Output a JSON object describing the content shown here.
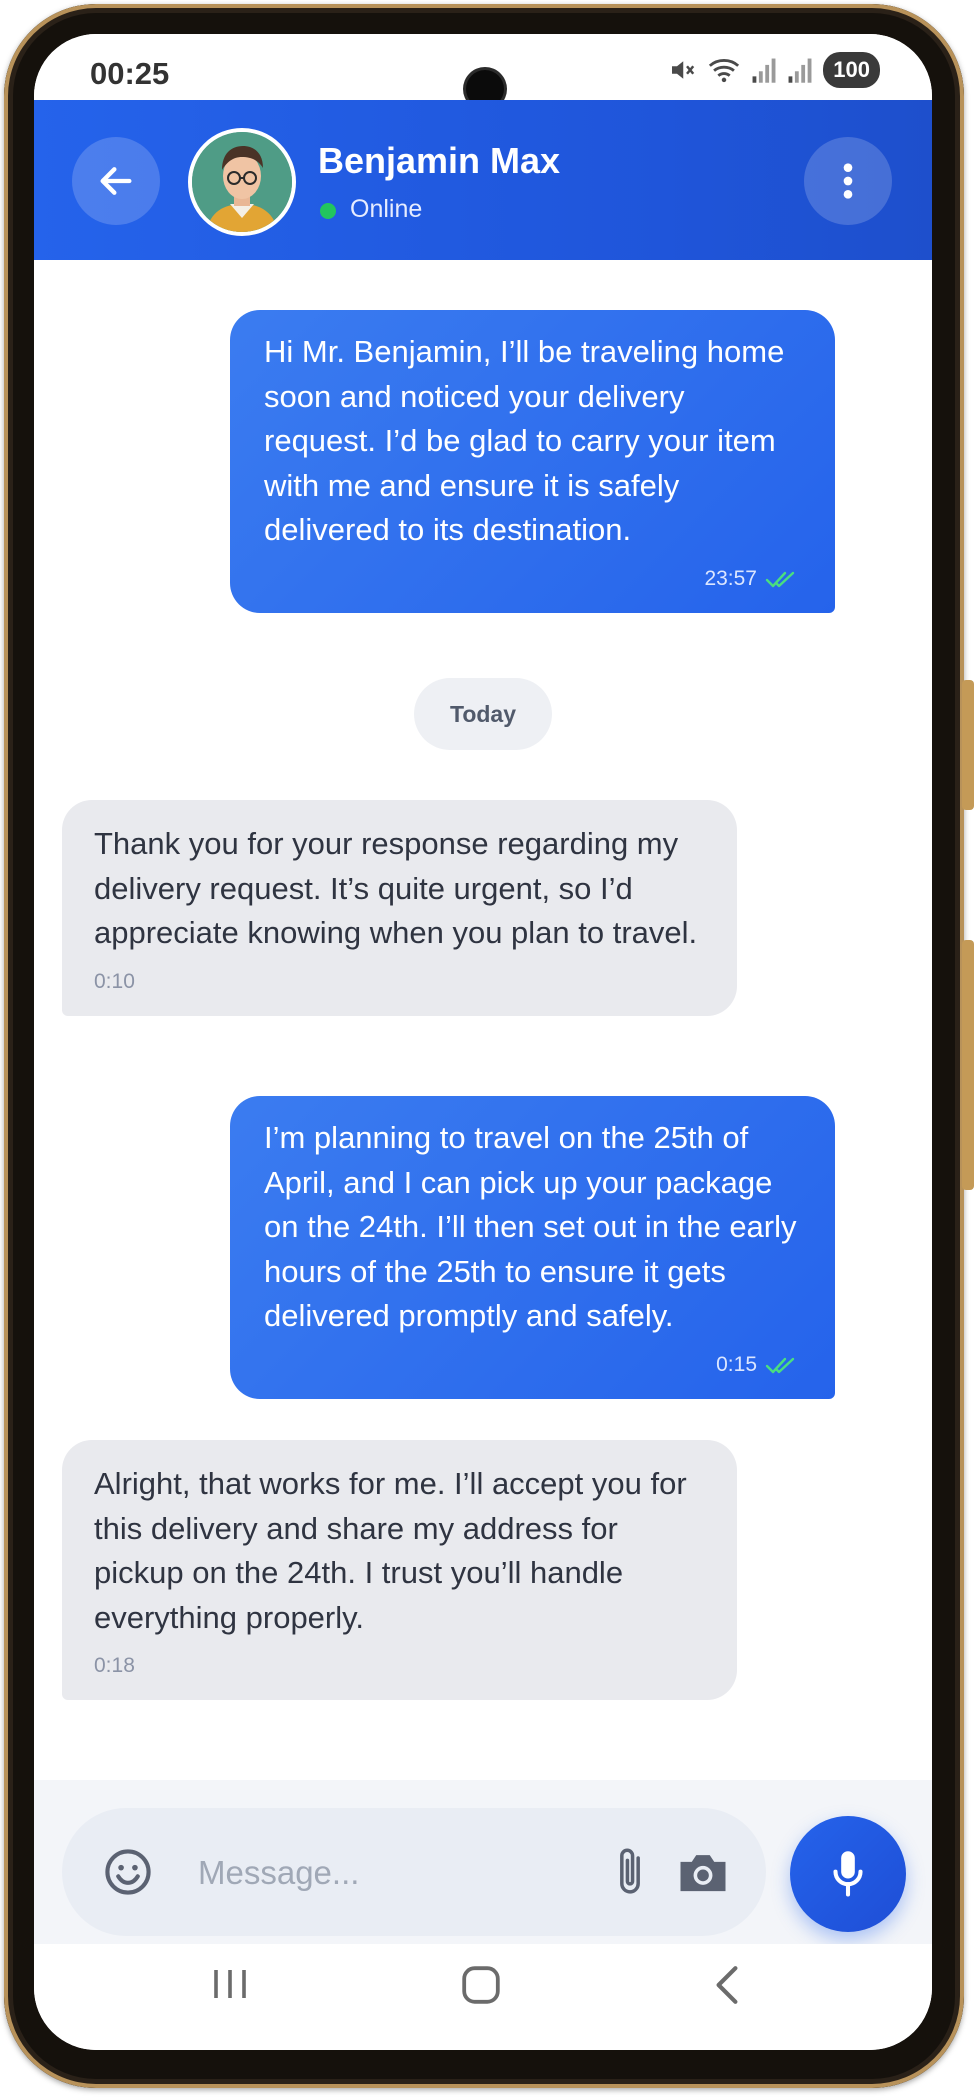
{
  "status_bar": {
    "time": "00:25",
    "battery": "100",
    "icons": [
      "mute-icon",
      "wifi-icon",
      "signal-icon",
      "signal-icon"
    ]
  },
  "header": {
    "contact_name": "Benjamin Max",
    "status": "Online",
    "back_icon": "arrow-left-icon",
    "menu_icon": "more-vertical-icon"
  },
  "messages": [
    {
      "direction": "outgoing",
      "text": "Hi Mr. Benjamin, I’ll be traveling home soon and noticed your delivery request. I’d be glad to carry your item with me and ensure it is safely delivered to its destination.",
      "time": "23:57",
      "status": "read"
    },
    {
      "direction": "incoming",
      "text": "Thank you for your response regarding my delivery request. It’s quite urgent, so I’d appreciate knowing when you plan to travel.",
      "time": "0:10"
    },
    {
      "direction": "outgoing",
      "text": "I’m planning to travel on the 25th of April, and I can pick up your package on the 24th. I’ll then set out in the early hours of the 25th to ensure it gets delivered promptly and safely.",
      "time": "0:15",
      "status": "read"
    },
    {
      "direction": "incoming",
      "text": "Alright, that works for me. I’ll accept you for this delivery and share my address for pickup on the 24th. I trust you’ll handle everything properly.",
      "time": "0:18"
    }
  ],
  "date_separator": "Today",
  "composer": {
    "placeholder": "Message...",
    "value": ""
  },
  "colors": {
    "accent": "#2563eb",
    "outgoing_bubble": "#2f6ff0",
    "incoming_bubble": "#e9eaee",
    "online": "#22c55e",
    "read_check": "#4ade80"
  }
}
